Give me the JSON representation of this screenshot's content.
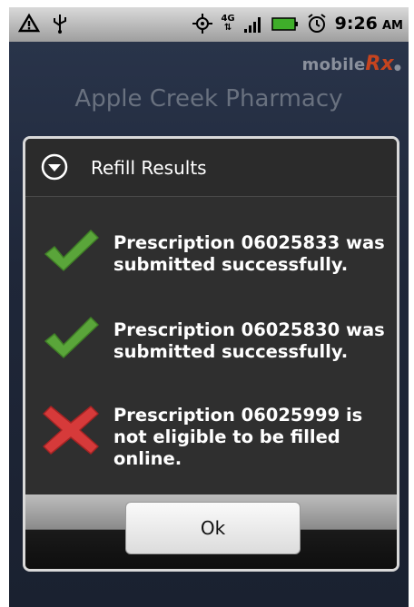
{
  "status_bar": {
    "time": "9:26",
    "am_pm": "AM",
    "network": "4G",
    "icons": [
      "warning-icon",
      "usb-icon",
      "gps-icon",
      "network-4g-icon",
      "signal-icon",
      "battery-icon",
      "alarm-icon"
    ]
  },
  "app": {
    "logo_prefix": "mobile",
    "logo_suffix": "Rx",
    "title": "Apple Creek Pharmacy"
  },
  "dialog": {
    "title": "Refill Results",
    "results": [
      {
        "text": "Prescription 06025833 was submitted successfully.",
        "status": "success",
        "icon": "check-icon"
      },
      {
        "text": "Prescription 06025830 was submitted successfully.",
        "status": "success",
        "icon": "check-icon"
      },
      {
        "text": "Prescription 06025999 is not eligible to be filled online.",
        "status": "error",
        "icon": "cross-icon"
      }
    ],
    "ok_label": "Ok"
  },
  "colors": {
    "success": "#5aa53a",
    "error": "#d63a3a",
    "background": "#1f2739",
    "logo_rx": "#c6441f"
  }
}
